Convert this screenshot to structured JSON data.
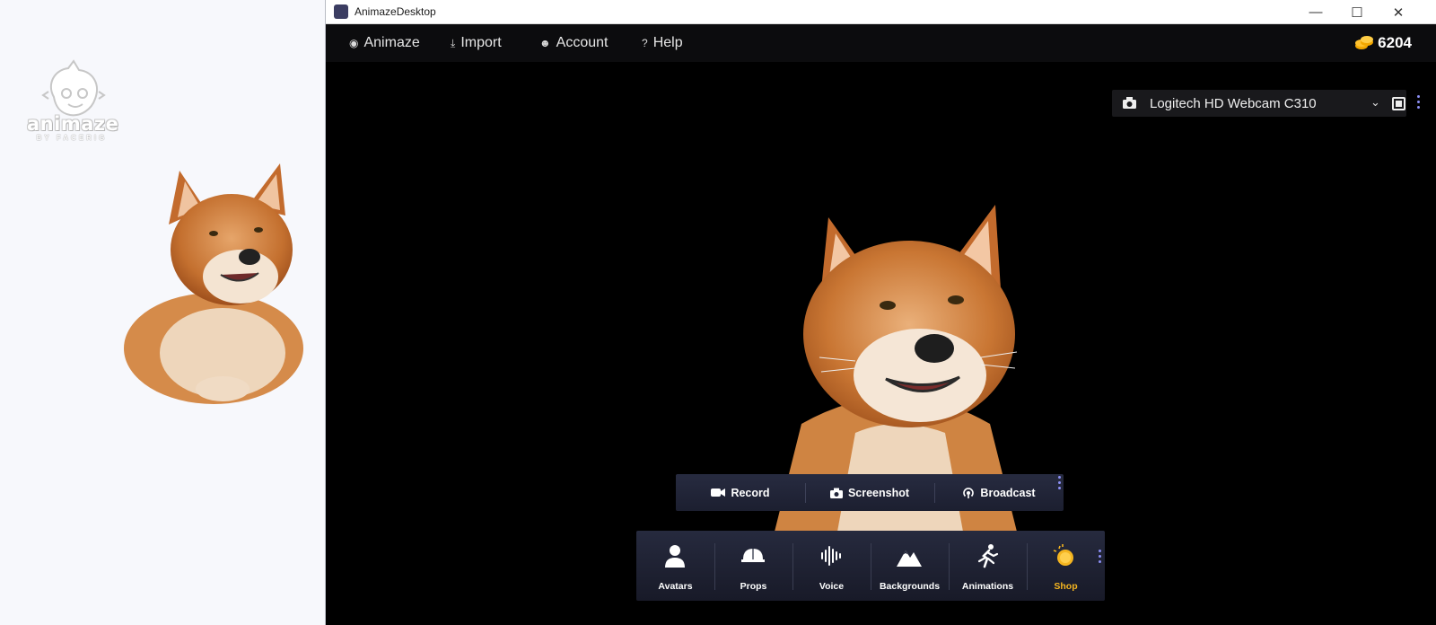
{
  "left_panel": {
    "logo_word": "animaze",
    "logo_sub": "BY FACERIG"
  },
  "window": {
    "title": "AnimazeDesktop"
  },
  "menu": {
    "items": [
      {
        "label": "Animaze",
        "icon": "animaze-icon"
      },
      {
        "label": "Import",
        "icon": "import-icon"
      },
      {
        "label": "Account",
        "icon": "account-icon"
      },
      {
        "label": "Help",
        "icon": "help-icon"
      }
    ],
    "coins": "6204"
  },
  "camera": {
    "name": "Logitech HD Webcam C310"
  },
  "record_bar": {
    "record": "Record",
    "screenshot": "Screenshot",
    "broadcast": "Broadcast"
  },
  "toolbar": {
    "items": [
      {
        "label": "Avatars",
        "icon": "person-icon"
      },
      {
        "label": "Props",
        "icon": "cap-icon"
      },
      {
        "label": "Voice",
        "icon": "waveform-icon"
      },
      {
        "label": "Backgrounds",
        "icon": "mountain-icon"
      },
      {
        "label": "Animations",
        "icon": "running-icon"
      },
      {
        "label": "Shop",
        "icon": "coin-icon"
      }
    ]
  },
  "colors": {
    "accent_shop": "#f5b520",
    "kebab": "#8c8ff5",
    "toolbar_bg": "#1f2233"
  }
}
